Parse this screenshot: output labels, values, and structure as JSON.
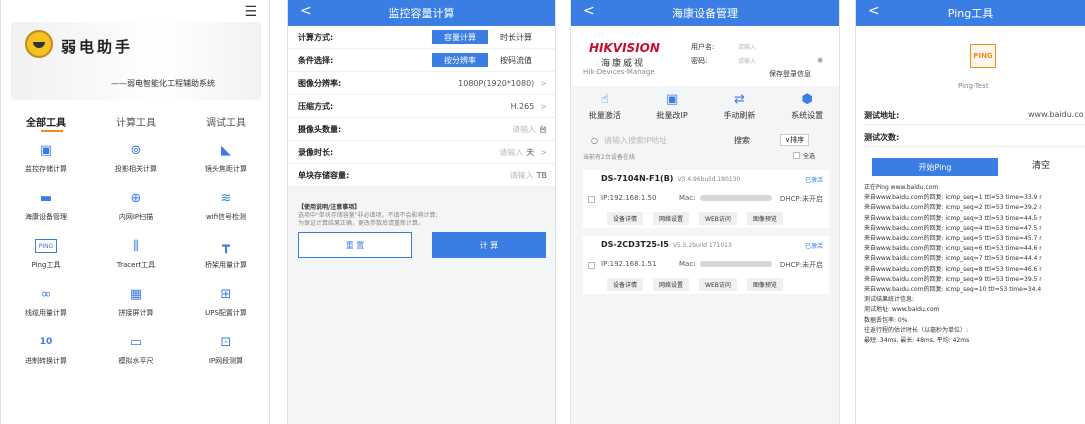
{
  "p1": {
    "brand": "弱电助手",
    "slogan": "——弱电智能化工程辅助系统",
    "tabs": [
      "全部工具",
      "计算工具",
      "调试工具"
    ],
    "tools": [
      {
        "label": "监控存储计算",
        "icon": "▣"
      },
      {
        "label": "投影相关计算",
        "icon": "⊚"
      },
      {
        "label": "镜头焦距计算",
        "icon": "◣"
      },
      {
        "label": "海康设备管理",
        "icon": "▬"
      },
      {
        "label": "内网IP扫描",
        "icon": "⊕"
      },
      {
        "label": "wifi信号检测",
        "icon": "≋"
      },
      {
        "label": "Ping工具",
        "icon": "PING"
      },
      {
        "label": "Tracert工具",
        "icon": "⫼"
      },
      {
        "label": "桥架用量计算",
        "icon": "┳"
      },
      {
        "label": "线缆用量计算",
        "icon": "∞"
      },
      {
        "label": "拼接屏计算",
        "icon": "▦"
      },
      {
        "label": "UPS配置计算",
        "icon": "⊞"
      },
      {
        "label": "进制转换计算",
        "icon": "10"
      },
      {
        "label": "模拟水平尺",
        "icon": "▭"
      },
      {
        "label": "IP网段测算",
        "icon": "⊡"
      }
    ]
  },
  "p2": {
    "title": "监控容量计算",
    "back": "<",
    "calc_label": "计算方式:",
    "calc_opt1": "容量计算",
    "calc_opt2": "时长计算",
    "cond_label": "条件选择:",
    "cond_opt1": "按分辨率",
    "cond_opt2": "按码流值",
    "res_label": "图像分辨率:",
    "res_value": "1080P(1920*1080)",
    "comp_label": "压缩方式:",
    "comp_value": "H.265",
    "cam_label": "摄像头数量:",
    "cam_ph": "请输入",
    "cam_unit": "台",
    "dur_label": "录像时长:",
    "dur_ph": "请输入",
    "dur_unit": "天",
    "cap_label": "单块存储容量:",
    "cap_ph": "请输入",
    "cap_unit": "TB",
    "note_title": "【使用说明/注意事项】",
    "note_l1": "选项中\"单块存储容量\"非必填项，不填不会影响计算;",
    "note_l2": "为保证计算结果正确，更改参数后请重新计算。",
    "reset": "重 置",
    "calc": "计 算"
  },
  "p3": {
    "title": "海康设备管理",
    "back": "<",
    "logo_en": "HIKVISION",
    "logo_cn": "海康威视",
    "logo_sub": "Hik-Devices-Manage",
    "user_label": "用户名:",
    "user_ph": "请输入",
    "pass_label": "密码:",
    "pass_ph": "请输入",
    "save_login": "保存登录信息",
    "actions": [
      {
        "label": "批量激活",
        "icon": "☝"
      },
      {
        "label": "批量改IP",
        "icon": "▣"
      },
      {
        "label": "手动刷新",
        "icon": "⇄"
      },
      {
        "label": "系统设置",
        "icon": "⬢"
      }
    ],
    "search_ph": "请输入搜索IP地址",
    "search_btn": "搜索",
    "sort": "∨排序",
    "online": "当前有2台设备在线",
    "select_all": "全选",
    "devices": [
      {
        "name": "DS-7104N-F1(B)",
        "ver": "V3.4.96build 180130",
        "status": "已激活",
        "ip": "IP:192.168.1.50",
        "mac": "Mac:",
        "dhcp": "DHCP:未开启",
        "btns": [
          "设备详情",
          "网络设置",
          "WEB访问",
          "图像预览"
        ]
      },
      {
        "name": "DS-2CD3T25-I5",
        "ver": "V5.5.2build 171013",
        "status": "已激活",
        "ip": "IP:192.168.1.51",
        "mac": "Mac:",
        "dhcp": "DHCP:未开启",
        "btns": [
          "设备详情",
          "网络设置",
          "WEB访问",
          "图像预览"
        ]
      }
    ]
  },
  "p4": {
    "title": "Ping工具",
    "back": "<",
    "logo": "PING",
    "sub": "Ping-Test",
    "addr_label": "测试地址:",
    "addr_value": "www.baidu.co",
    "cnt_label": "测试次数:",
    "start": "开始Ping",
    "clear": "清空",
    "log": [
      "正在Ping www.baidu.com",
      "来自www.baidu.com的回复:  icmp_seq=1 ttl=53 time=33.9 r",
      "来自www.baidu.com的回复:  icmp_seq=2 ttl=53 time=39.2 r",
      "来自www.baidu.com的回复:  icmp_seq=3 ttl=53 time=44.5 r",
      "来自www.baidu.com的回复:  icmp_seq=4 ttl=53 time=47.5 r",
      "来自www.baidu.com的回复:  icmp_seq=5 ttl=53 time=45.7 r",
      "来自www.baidu.com的回复:  icmp_seq=6 ttl=53 time=44.6 r",
      "来自www.baidu.com的回复:  icmp_seq=7 ttl=53 time=44.4 r",
      "来自www.baidu.com的回复:  icmp_seq=8 ttl=53 time=46.6 r",
      "来自www.baidu.com的回复:  icmp_seq=9 ttl=53 time=39.5 r",
      "来自www.baidu.com的回复:  icmp_seq=10 ttl=53 time=34.4",
      "测试结果统计信息:",
      "测试地址:  www.baidu.com",
      "数据丢包率:  0%",
      "往返行程的估计时长（以毫秒为单位）:",
      "最短:  34ms,  最长:  48ms,  平均:  42ms"
    ]
  }
}
